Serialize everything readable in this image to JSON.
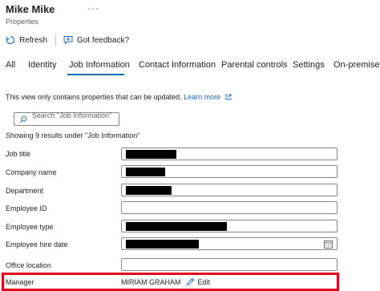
{
  "header": {
    "title": "Mike Mike",
    "more": "···",
    "subtitle": "Properties"
  },
  "toolbar": {
    "refresh_label": "Refresh",
    "feedback_label": "Got feedback?"
  },
  "tabs": [
    {
      "label": "All"
    },
    {
      "label": "Identity"
    },
    {
      "label": "Job Information",
      "active": true
    },
    {
      "label": "Contact Information"
    },
    {
      "label": "Parental controls"
    },
    {
      "label": "Settings"
    },
    {
      "label": "On-premises"
    }
  ],
  "info": {
    "text": "This view only contains properties that can be updated.",
    "link": "Learn more"
  },
  "search": {
    "placeholder": "Search \"Job Information\" ..."
  },
  "results_text": "Showing 9 results under \"Job Information\"",
  "fields": {
    "job_title": {
      "label": "Job title"
    },
    "company_name": {
      "label": "Company name"
    },
    "department": {
      "label": "Department"
    },
    "employee_id": {
      "label": "Employee ID"
    },
    "employee_type": {
      "label": "Employee type"
    },
    "employee_hire_date": {
      "label": "Employee hire date"
    },
    "office_location": {
      "label": "Office location"
    }
  },
  "manager": {
    "label": "Manager",
    "value": "MIRIAM GRAHAM",
    "edit_label": "Edit"
  },
  "colors": {
    "accent": "#0f6cbd",
    "highlight": "#e3001b"
  }
}
